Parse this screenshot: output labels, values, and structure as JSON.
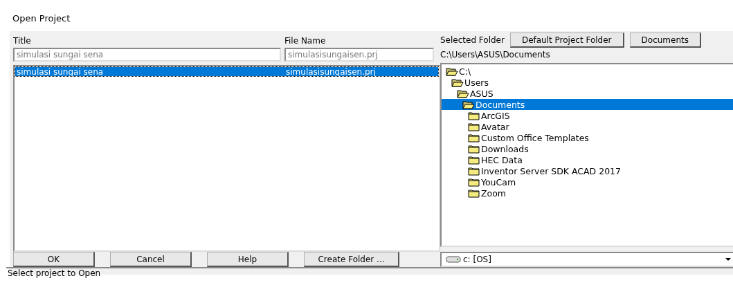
{
  "window": {
    "title": "Open Project"
  },
  "title_field": {
    "label": "Title",
    "value": "simulasi sungai sena"
  },
  "file_field": {
    "label": "File Name",
    "value": "simulasisungaisen.prj"
  },
  "projects": [
    {
      "title": "simulasi sungai sena",
      "file": "simulasisungaisen.prj",
      "selected": true
    }
  ],
  "folder": {
    "label": "Selected Folder",
    "path": "C:\\Users\\ASUS\\Documents",
    "buttons": [
      "Default Project Folder",
      "Documents"
    ]
  },
  "tree": [
    {
      "name": "C:\\",
      "expanded": true,
      "selected": false,
      "children": [
        {
          "name": "Users",
          "expanded": true,
          "selected": false,
          "children": [
            {
              "name": "ASUS",
              "expanded": true,
              "selected": false,
              "children": [
                {
                  "name": "Documents",
                  "expanded": true,
                  "selected": true,
                  "children": [
                    {
                      "name": "ArcGIS",
                      "expanded": false,
                      "selected": false
                    },
                    {
                      "name": "Avatar",
                      "expanded": false,
                      "selected": false
                    },
                    {
                      "name": "Custom Office Templates",
                      "expanded": false,
                      "selected": false
                    },
                    {
                      "name": "Downloads",
                      "expanded": false,
                      "selected": false
                    },
                    {
                      "name": "HEC Data",
                      "expanded": false,
                      "selected": false
                    },
                    {
                      "name": "Inventor Server SDK ACAD 2017",
                      "expanded": false,
                      "selected": false
                    },
                    {
                      "name": "YouCam",
                      "expanded": false,
                      "selected": false
                    },
                    {
                      "name": "Zoom",
                      "expanded": false,
                      "selected": false
                    }
                  ]
                }
              ]
            }
          ]
        }
      ]
    }
  ],
  "buttons": [
    "OK",
    "Cancel",
    "Help",
    "Create Folder ..."
  ],
  "drive": {
    "value": "c: [OS]"
  },
  "status_bar": "Select project to Open"
}
